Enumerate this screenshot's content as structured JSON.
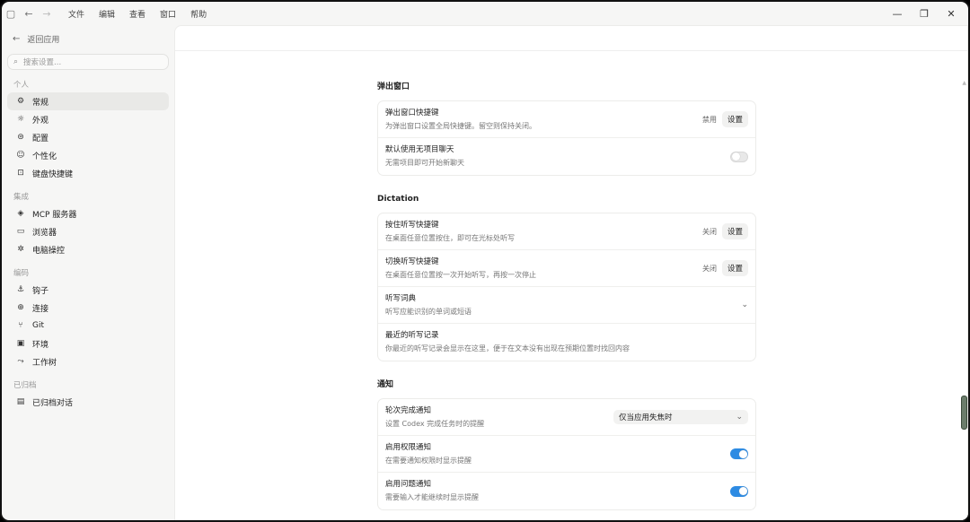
{
  "titlebar": {
    "menu": [
      "文件",
      "编辑",
      "查看",
      "窗口",
      "帮助"
    ]
  },
  "sidebar": {
    "back_label": "返回应用",
    "search_placeholder": "搜索设置...",
    "groups": [
      {
        "label": "个人",
        "items": [
          {
            "label": "常规",
            "icon": "gear-icon",
            "active": true
          },
          {
            "label": "外观",
            "icon": "sun-icon"
          },
          {
            "label": "配置",
            "icon": "config-icon"
          },
          {
            "label": "个性化",
            "icon": "smile-icon"
          },
          {
            "label": "键盘快捷键",
            "icon": "keyboard-icon"
          }
        ]
      },
      {
        "label": "集成",
        "items": [
          {
            "label": "MCP 服务器",
            "icon": "mcp-icon"
          },
          {
            "label": "浏览器",
            "icon": "browser-icon"
          },
          {
            "label": "电脑操控",
            "icon": "sparkle-icon"
          }
        ]
      },
      {
        "label": "编码",
        "items": [
          {
            "label": "钩子",
            "icon": "anchor-icon"
          },
          {
            "label": "连接",
            "icon": "globe-icon"
          },
          {
            "label": "Git",
            "icon": "git-icon"
          },
          {
            "label": "环境",
            "icon": "terminal-icon"
          },
          {
            "label": "工作树",
            "icon": "worktree-icon"
          }
        ]
      },
      {
        "label": "已归档",
        "items": [
          {
            "label": "已归档对话",
            "icon": "archive-icon"
          }
        ]
      }
    ]
  },
  "sections": [
    {
      "title": "弹出窗口",
      "rows": [
        {
          "title": "弹出窗口快捷键",
          "desc": "为弹出窗口设置全局快捷键。留空则保持关闭。",
          "state": "禁用",
          "button": "设置"
        },
        {
          "title": "默认使用无项目聊天",
          "desc": "无需项目即可开始新聊天",
          "toggle": false
        }
      ]
    },
    {
      "title": "Dictation",
      "rows": [
        {
          "title": "按住听写快捷键",
          "desc": "在桌面任意位置按住，即可在光标处听写",
          "state": "关闭",
          "button": "设置"
        },
        {
          "title": "切换听写快捷键",
          "desc": "在桌面任意位置按一次开始听写，再按一次停止",
          "state": "关闭",
          "button": "设置"
        },
        {
          "title": "听写词典",
          "desc": "听写应能识别的单词或短语",
          "chevron": true
        },
        {
          "title": "最近的听写记录",
          "desc": "你最近的听写记录会显示在这里，便于在文本没有出现在预期位置时找回内容"
        }
      ]
    },
    {
      "title": "通知",
      "rows": [
        {
          "title": "轮次完成通知",
          "desc": "设置 Codex 完成任务时的提醒",
          "select": "仅当应用失焦时"
        },
        {
          "title": "启用权限通知",
          "desc": "在需要通知权限时显示提醒",
          "toggle": true
        },
        {
          "title": "启用问题通知",
          "desc": "需要输入才能继续时显示提醒",
          "toggle": true
        }
      ]
    }
  ],
  "colors": {
    "accent": "#2d8be3",
    "sidebar_bg": "#f6f6f5",
    "active_item": "#e9e9e7"
  }
}
